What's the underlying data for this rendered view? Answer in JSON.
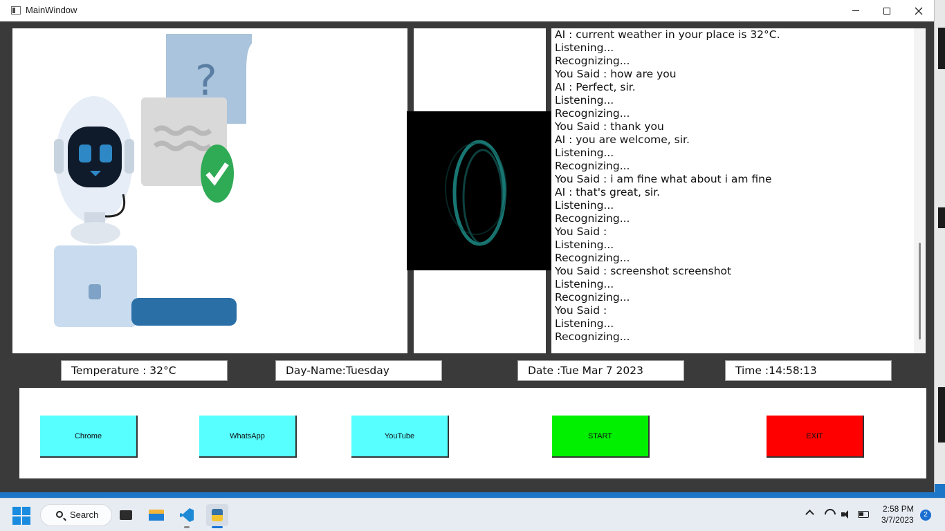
{
  "window": {
    "title": "MainWindow"
  },
  "log": {
    "lines": [
      "AI : current weather in your place is 32°C.",
      "Listening...",
      "Recognizing...",
      "You Said : how are you",
      "AI : Perfect, sir.",
      "Listening...",
      "Recognizing...",
      "You Said : thank you",
      "AI : you are welcome, sir.",
      "Listening...",
      "Recognizing...",
      "You Said : i am fine what about i am fine",
      "AI : that's great, sir.",
      "Listening...",
      "Recognizing...",
      "You Said :",
      "Listening...",
      "Recognizing...",
      "You Said : screenshot screenshot",
      "Listening...",
      "Recognizing...",
      "You Said :",
      "Listening...",
      "Recognizing..."
    ]
  },
  "info": {
    "temperature": "Temperature : 32°C",
    "day_name": "Day-Name:Tuesday",
    "date": "Date :Tue Mar 7 2023",
    "time": "Time :14:58:13"
  },
  "buttons": {
    "chrome": "Chrome",
    "whatsapp": "WhatsApp",
    "youtube": "YouTube",
    "start": "START",
    "exit": "EXIT"
  },
  "taskbar": {
    "search_label": "Search",
    "clock_time": "2:58 PM",
    "clock_date": "3/7/2023",
    "notifications": "2"
  },
  "colors": {
    "app_button": "#58ffff",
    "start_button": "#00f000",
    "exit_button": "#ff0000"
  }
}
